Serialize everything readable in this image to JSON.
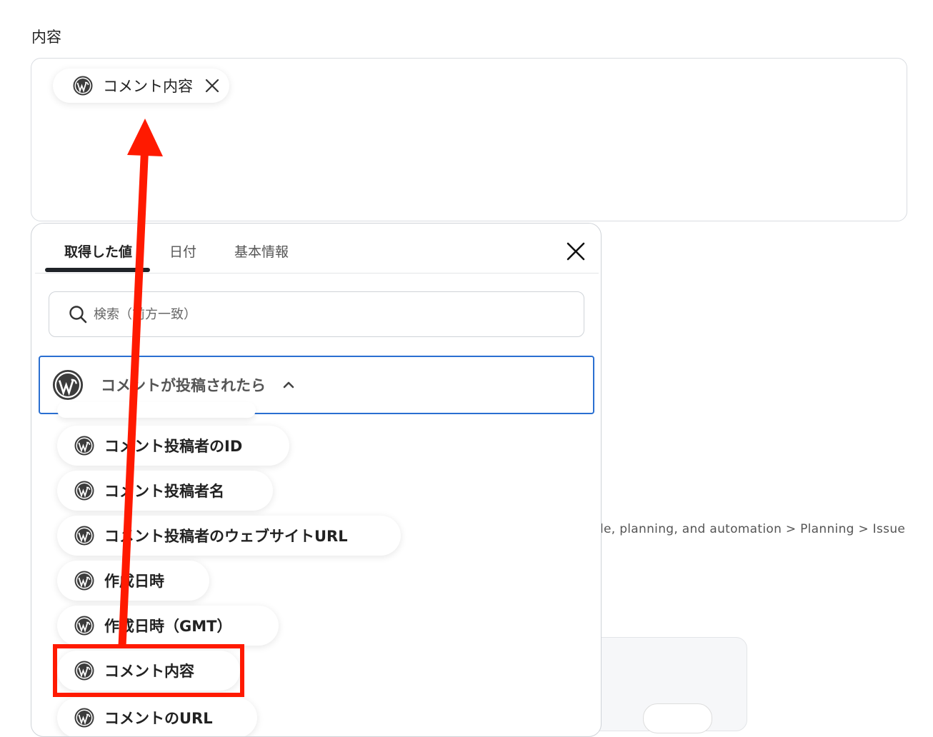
{
  "field": {
    "label": "内容"
  },
  "selected_chip": {
    "label": "コメント内容",
    "remove_icon": "close-icon",
    "icon": "wordpress-icon"
  },
  "background": {
    "breadcrumb_fragment": "le, planning, and automation > Planning > Issue"
  },
  "picker": {
    "tabs": [
      {
        "label": "取得した値",
        "active": true
      },
      {
        "label": "日付",
        "active": false
      },
      {
        "label": "基本情報",
        "active": false
      }
    ],
    "close_icon": "close-icon",
    "search": {
      "placeholder": "検索（前方一致）",
      "icon": "search-icon"
    },
    "trigger_group": {
      "label": "コメントが投稿されたら",
      "expanded": true,
      "icon": "wordpress-icon"
    },
    "items": [
      {
        "label": "コメント投稿者のID"
      },
      {
        "label": "コメント投稿者名"
      },
      {
        "label": "コメント投稿者のウェブサイトURL"
      },
      {
        "label": "作成日時"
      },
      {
        "label": "作成日時（GMT）"
      },
      {
        "label": "コメント内容",
        "highlighted": true
      },
      {
        "label": "コメントのURL"
      }
    ]
  },
  "annotation": {
    "highlight_color": "#ff1a00",
    "arrow_color": "#ff1a00"
  },
  "colors": {
    "accent_border": "#2a6fd1",
    "tab_indicator": "#1f2328"
  }
}
